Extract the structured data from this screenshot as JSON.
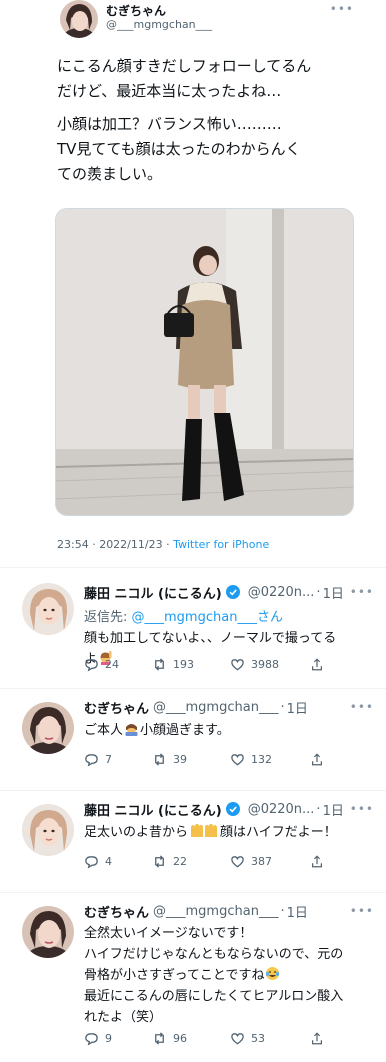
{
  "main_tweet": {
    "name": "むぎちゃん",
    "handle": "@___mgmgchan___",
    "paragraphs": [
      "にこるん顔すきだしフォローしてるん\nだけど、最近本当に太ったよね…",
      "小顔は加工？バランス怖い………\nTV見てても顔は太ったのわからんく\nての羨ましい。"
    ],
    "timestamp": "23:54 · 2022/11/23 · ",
    "source": "Twitter for iPhone"
  },
  "replies": [
    {
      "name": "藤田 ニコル (にこるん)",
      "verified": true,
      "handle": "@0220n...",
      "time": "1日",
      "reply_to_prefix": "返信先: ",
      "reply_to_handle": "@___mgmgchan___",
      "reply_to_suffix": "さん",
      "text_1": "顔も加工してないよ、、ノーマルで撮ってる\nよ",
      "reply_count": "24",
      "retweet_count": "193",
      "like_count": "3988"
    },
    {
      "name": "むぎちゃん",
      "verified": false,
      "handle": "@___mgmgchan___",
      "time": "1日",
      "text_1": "ご本人",
      "text_2": "小顔過ぎます。",
      "reply_count": "7",
      "retweet_count": "39",
      "like_count": "132"
    },
    {
      "name": "藤田 ニコル (にこるん)",
      "verified": true,
      "handle": "@0220n...",
      "time": "1日",
      "text_1": "足太いのよ昔から",
      "text_2": "顔はハイフだよー！",
      "reply_count": "4",
      "retweet_count": "22",
      "like_count": "387"
    },
    {
      "name": "むぎちゃん",
      "verified": false,
      "handle": "@___mgmgchan___",
      "time": "1日",
      "text_1": "全然太いイメージないです！\nハイフだけじゃなんともならないので、元の\n骨格が小さすぎってことですね",
      "text_2": "\n最近にこるんの唇にしたくてヒアルロン酸入\nれたよ（笑）",
      "reply_count": "9",
      "retweet_count": "96",
      "like_count": "53"
    }
  ],
  "icons": {
    "more": "more-dots-icon",
    "reply": "reply-bubble-icon",
    "retweet": "retweet-arrows-icon",
    "like": "heart-icon",
    "share": "share-upload-icon",
    "verified": "verified-badge-icon"
  },
  "colors": {
    "accent": "#1d9bf0",
    "secondary_text": "#536471",
    "primary_text": "#0f1419"
  }
}
